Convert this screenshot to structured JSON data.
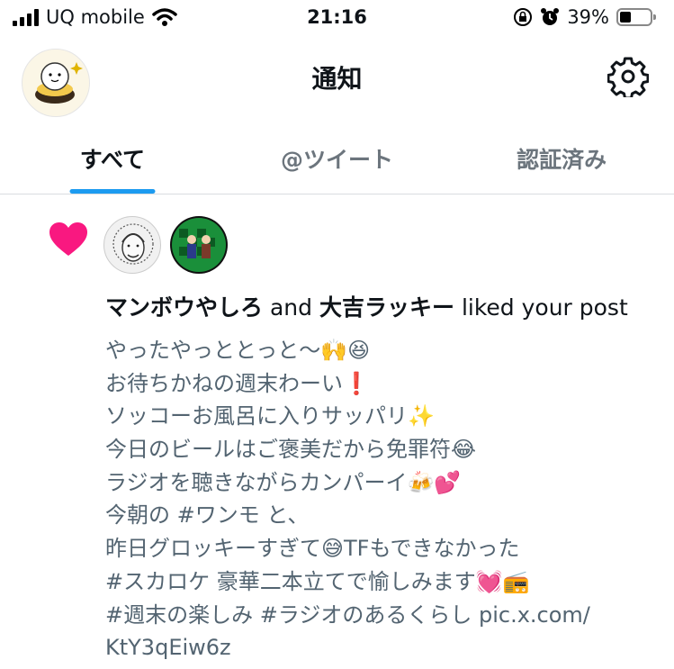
{
  "status_bar": {
    "carrier": "UQ mobile",
    "time": "21:16",
    "battery_percent": "39%",
    "battery_level": 0.39,
    "icons": [
      "signal-icon",
      "wifi-icon",
      "orientation-lock-icon",
      "alarm-icon",
      "battery-icon"
    ]
  },
  "header": {
    "title": "通知",
    "settings_icon": "gear-icon"
  },
  "tabs": [
    {
      "label": "すべて",
      "active": true
    },
    {
      "label": "@ツイート",
      "active": false
    },
    {
      "label": "認証済み",
      "active": false
    }
  ],
  "notification": {
    "type_icon": "heart-icon",
    "user1": "マンボウやしろ",
    "connector": "and",
    "user2": "大吉ラッキー",
    "action": "liked your post",
    "post_lines": [
      "やったやっととっと〜🙌😆",
      "お待ちかねの週末わーい❗️",
      "ソッコーお風呂に入りサッパリ✨",
      "今日のビールはご褒美だから免罪符😂",
      "ラジオを聴きながらカンパーイ🍻💕",
      "今朝の #ワンモ と、",
      "昨日グロッキーすぎて😅TFもできなかった",
      "#スカロケ 豪華二本立てで愉しみます💓📻",
      "#週末の楽しみ #ラジオのあるくらし pic.x.com/",
      "KtY3qEiw6z"
    ]
  },
  "colors": {
    "accent_blue": "#1d9bf0",
    "heart_pink": "#f91880",
    "text_primary": "#0f1419",
    "text_secondary": "#536471"
  }
}
